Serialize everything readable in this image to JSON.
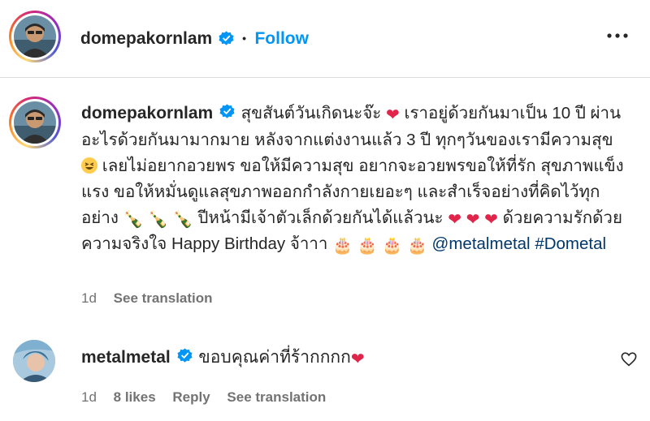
{
  "post_header": {
    "username": "domepakornlam",
    "separator": "•",
    "follow_label": "Follow"
  },
  "caption": {
    "username": "domepakornlam",
    "part1": "สุขสันต์วันเกิดนะจ๊ะ",
    "part2": "เราอยู่ด้วยกันมาเป็น 10 ปี ผ่านอะไรด้วยกันมามากมาย หลังจากแต่งงานแล้ว 3 ปี ทุกๆวันของเรามีความสุข",
    "part3": "เลยไม่อยากอวยพร ขอให้มีความสุข อยากจะอวยพรขอให้ที่รัก สุขภาพแข็งแรง ขอให้หมั่นดูแลสุขภาพออกกำลังกายเยอะๆ และสำเร็จอย่างที่คิดไว้ทุกอย่าง",
    "part4": "ปีหน้ามีเจ้าตัวเล็กด้วยกันได้แล้วนะ",
    "part5": "ด้วยความรักด้วยความจริงใจ Happy Birthday จ้าาา",
    "tag1": "@metalmetal",
    "tag2": "#Dometal",
    "time": "1d",
    "see_translation": "See translation",
    "icons": [
      "heart-emoji",
      "laughing-emoji",
      "champagne-emoji",
      "birthday-cake-emoji"
    ]
  },
  "comment": {
    "username": "metalmetal",
    "text": "ขอบคุณค่าที่ร้ากกกก",
    "time": "1d",
    "likes": "8 likes",
    "reply_label": "Reply",
    "see_translation": "See translation"
  },
  "colors": {
    "link_blue": "#0095f6",
    "tag_blue": "#00376b",
    "verified_blue": "#0095f6",
    "heart_red": "#e0244a",
    "meta_gray": "#737373"
  }
}
